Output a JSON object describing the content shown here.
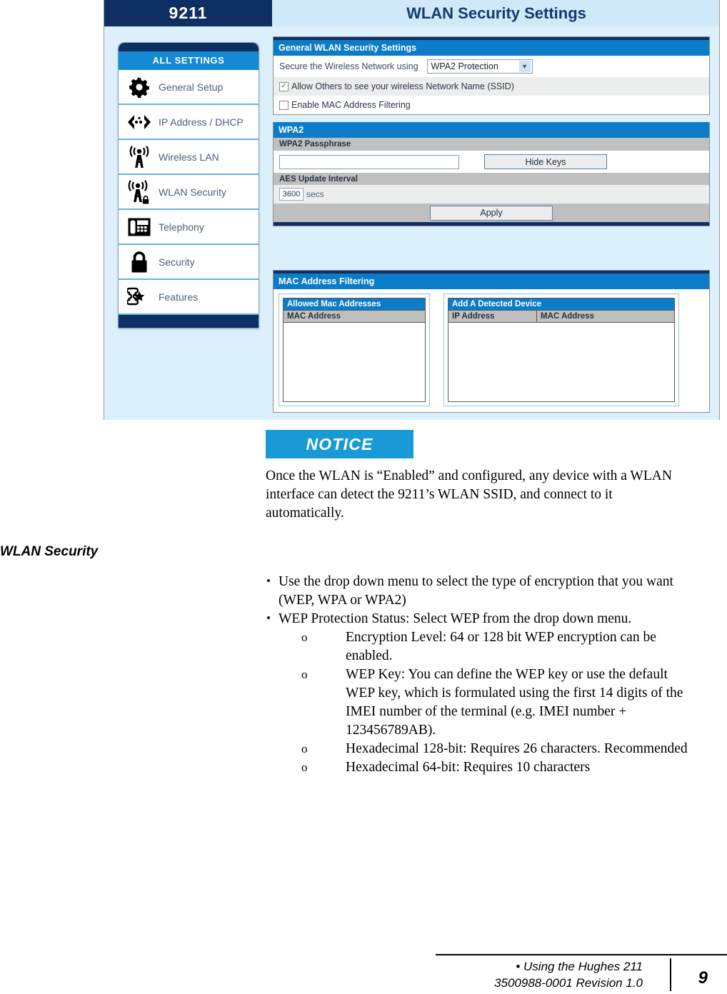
{
  "screenshot": {
    "device_tab": "9211",
    "window_title": "WLAN Security Settings",
    "sidebar": {
      "header": "ALL SETTINGS",
      "items": [
        {
          "label": "General Setup",
          "icon": "gear-icon"
        },
        {
          "label": "IP Address / DHCP",
          "icon": "network-arrows-icon"
        },
        {
          "label": "Wireless LAN",
          "icon": "antenna-icon"
        },
        {
          "label": "WLAN Security",
          "icon": "antenna-lock-icon"
        },
        {
          "label": "Telephony",
          "icon": "telephone-icon"
        },
        {
          "label": "Security",
          "icon": "padlock-icon"
        },
        {
          "label": "Features",
          "icon": "puzzle-star-icon"
        }
      ]
    },
    "general_panel": {
      "header": "General WLAN Security Settings",
      "secure_label": "Secure the Wireless Network using",
      "secure_value": "WPA2 Protection",
      "secure_options": [
        "WPA2 Protection"
      ],
      "checkbox_ssid": {
        "label": "Allow Others to see your wireless Network Name (SSID)",
        "checked": true,
        "mark": "✓"
      },
      "checkbox_mac": {
        "label": "Enable MAC Address Filtering",
        "checked": false,
        "mark": ""
      }
    },
    "wpa2_panel": {
      "header": "WPA2",
      "passphrase_label": "WPA2 Passphrase",
      "passphrase_value": "",
      "hide_keys_button": "Hide Keys",
      "aes_label": "AES Update Interval",
      "aes_value": "3600",
      "aes_unit": "secs",
      "apply_button": "Apply"
    },
    "mac_panel": {
      "header": "MAC Address Filtering",
      "allowed": {
        "title": "Allowed Mac Addresses",
        "columns": [
          "MAC Address"
        ],
        "rows": []
      },
      "detected": {
        "title": "Add A Detected Device",
        "columns": [
          "IP Address",
          "MAC Address"
        ],
        "rows": []
      }
    }
  },
  "notice": {
    "badge": "NOTICE",
    "body": "Once the WLAN is “Enabled” and configured, any device with a WLAN interface can detect the 9211’s WLAN SSID, and connect to it automatically."
  },
  "section": {
    "heading": "WLAN Security",
    "bullets": [
      {
        "text": "Use the drop down menu to select the type of encryption that you want (WEP, WPA or WPA2)",
        "sub": []
      },
      {
        "text": "WEP Protection Status:  Select WEP from the drop down menu.",
        "sub": [
          "Encryption Level:  64 or 128 bit WEP encryption can be enabled.",
          "WEP Key:  You can define the WEP key or use the default WEP key, which is formulated using the first 14 digits of the IMEI number of the terminal (e.g. IMEI number + 123456789AB).",
          "Hexadecimal 128-bit: Requires 26 characters. Recommended",
          "Hexadecimal 64-bit: Requires 10 characters"
        ]
      }
    ]
  },
  "footer": {
    "line1": "• Using the Hughes 211",
    "line2": "3500988-0001  Revision 1.0",
    "page_number": "9"
  },
  "colors": {
    "navy": "#0f2f62",
    "blue_header": "#0c7cc8",
    "accent_blue": "#1489d4",
    "notice_blue": "#199ad6",
    "pale_blue": "#dcf0fb"
  }
}
